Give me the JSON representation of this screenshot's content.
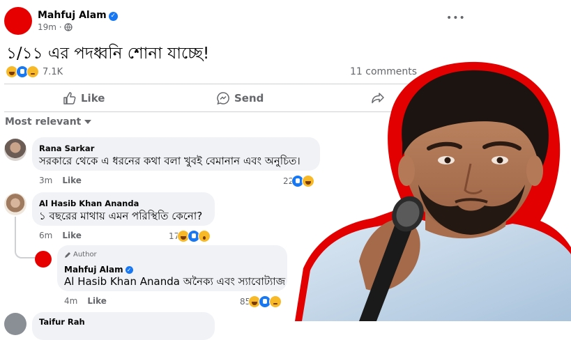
{
  "post": {
    "author": "Mahfuj Alam",
    "time": "19m ·",
    "text": "১/১১ এর পদধ্বনি শোনা যাচ্ছে!",
    "reaction_count": "7.1K",
    "comments_count": "11 comments",
    "more_label": "•••"
  },
  "actions": {
    "like": "Like",
    "send": "Send"
  },
  "sort": {
    "label": "Most relevant"
  },
  "comments": [
    {
      "name": "Rana Sarkar",
      "text": "সরকারে থেকে এ ধরনের কথা বলা খুবই বেমানান এবং অনুচিত।",
      "time": "3m",
      "like": "Like",
      "reactions": "22"
    },
    {
      "name": "Al Hasib Khan Ananda",
      "text": "১ বছরের মাথায় এমন পরিস্থিতি কেনো?",
      "time": "6m",
      "like": "Like",
      "reactions": "17"
    }
  ],
  "reply": {
    "badge": "Author",
    "name": "Mahfuj Alam",
    "mention": "Al Hasib Khan Ananda",
    "text": " অনৈক্য এবং স্যাবোট্যাজ",
    "time": "4m",
    "like": "Like",
    "reactions": "85"
  },
  "next_comment": {
    "name": "Taifur Rah"
  },
  "colors": {
    "accent": "#1877f2",
    "frame": "#e30000",
    "avatar_red": "#e60000"
  }
}
